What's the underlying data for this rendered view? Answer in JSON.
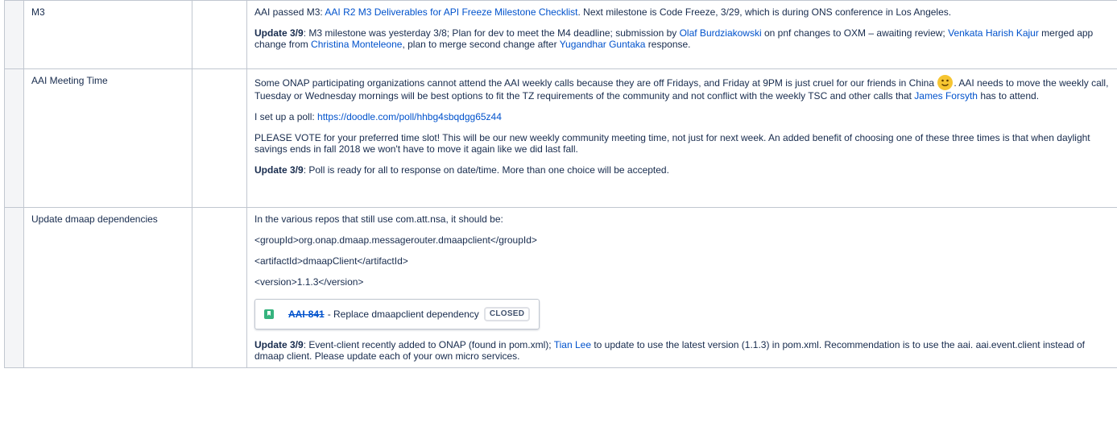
{
  "rows": [
    {
      "topic": "M3",
      "intro_prefix": "AAI passed M3: ",
      "intro_link": "AAI R2 M3 Deliverables for API Freeze Milestone Checklist",
      "intro_suffix": ". Next milestone is Code Freeze, 3/29, which is during ONS conference in Los Angeles.",
      "update_label": "Update 3/9",
      "update_a": ": M3 milestone was yesterday 3/8;  Plan for dev to meet the M4 deadline; submission by ",
      "link_olaf": "Olaf Burdziakowski",
      "update_b": " on pnf changes to OXM – awaiting review; ",
      "link_venkata": "Venkata Harish Kajur",
      "update_c": " merged app change from ",
      "link_christina": "Christina Monteleone",
      "update_d": ", plan to merge second change after ",
      "link_yugandhar": "Yugandhar Guntaka",
      "update_e": " response."
    },
    {
      "topic": "AAI Meeting Time",
      "p1a": "Some ONAP participating organizations cannot attend the AAI weekly calls because they are off Fridays, and Friday at 9PM is just cruel for our friends in China ",
      "p1b": ". AAI needs to move the weekly call, Tuesday or Wednesday mornings will be best options to fit the TZ requirements of the community and not conflict with the weekly TSC and other calls that ",
      "link_james": "James Forsyth",
      "p1c": " has to attend.",
      "poll_prefix": "I set up a poll: ",
      "poll_link": "https://doodle.com/poll/hhbg4sbqdgg65z44",
      "p3": "PLEASE VOTE for your preferred time slot! This will be our new weekly community meeting time, not just for next week. An added benefit of choosing one of these three times is that when daylight savings ends in fall 2018 we won't have to move it again like we did last fall.",
      "update_label": "Update 3/9",
      "update_text": ": Poll is ready for all to response on date/time.  More than one choice will be accepted."
    },
    {
      "topic": "Update dmaap dependencies",
      "p1": "In the various repos that still use com.att.nsa, it should be:",
      "p2": "<groupId>org.onap.dmaap.messagerouter.dmaapclient</groupId>",
      "p3": "<artifactId>dmaapClient</artifactId>",
      "p4": "<version>1.1.3</version>",
      "jira": {
        "key": "AAI-841",
        "summary": "- Replace dmaapclient dependency",
        "status": "CLOSED"
      },
      "update_label": "Update 3/9",
      "update_a": ": Event-client recently added to ONAP (found in pom.xml); ",
      "link_tian": "Tian Lee",
      "update_b": " to update to use the latest version (1.1.3) in pom.xml.  Recommendation is to use the aai. aai.event.client instead of dmaap client. Please update each of your own micro services."
    }
  ]
}
